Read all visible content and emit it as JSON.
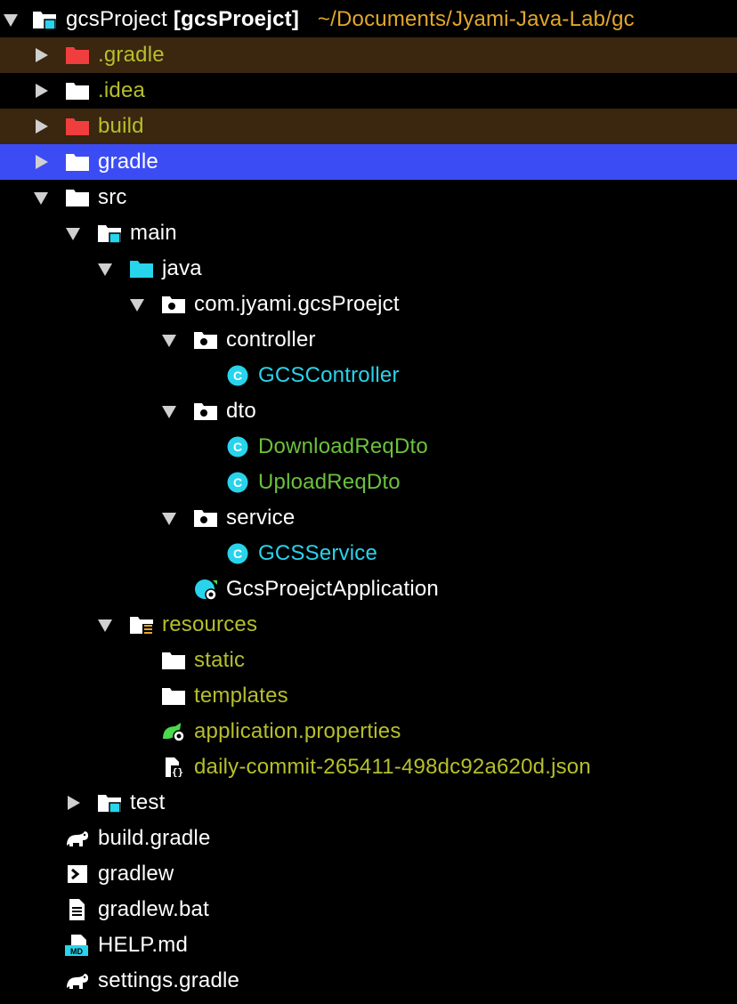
{
  "colors": {
    "excluded_bg": "#3b2610",
    "selected_bg": "#3c4cf5",
    "default_text": "#ffffff",
    "excluded_text": "#b6bf2c",
    "modified_text": "#6bc13d",
    "class_text": "#28d4ec",
    "path_text": "#e3a72b",
    "folder_white": "#ffffff",
    "folder_red": "#f03e3e",
    "folder_cyan": "#28d4ec"
  },
  "root": {
    "name": "gcsProject",
    "module": "[gcsProejct]",
    "path": "~/Documents/Jyami-Java-Lab/gc"
  },
  "items": [
    {
      "label": ".gradle"
    },
    {
      "label": ".idea"
    },
    {
      "label": "build"
    },
    {
      "label": "gradle"
    },
    {
      "label": "src"
    },
    {
      "label": "main"
    },
    {
      "label": "java"
    },
    {
      "label": "com.jyami.gcsProejct"
    },
    {
      "label": "controller"
    },
    {
      "label": "GCSController"
    },
    {
      "label": "dto"
    },
    {
      "label": "DownloadReqDto"
    },
    {
      "label": "UploadReqDto"
    },
    {
      "label": "service"
    },
    {
      "label": "GCSService"
    },
    {
      "label": "GcsProejctApplication"
    },
    {
      "label": "resources"
    },
    {
      "label": "static"
    },
    {
      "label": "templates"
    },
    {
      "label": "application.properties"
    },
    {
      "label": "daily-commit-265411-498dc92a620d.json"
    },
    {
      "label": "test"
    },
    {
      "label": "build.gradle"
    },
    {
      "label": "gradlew"
    },
    {
      "label": "gradlew.bat"
    },
    {
      "label": "HELP.md"
    },
    {
      "label": "settings.gradle"
    }
  ]
}
